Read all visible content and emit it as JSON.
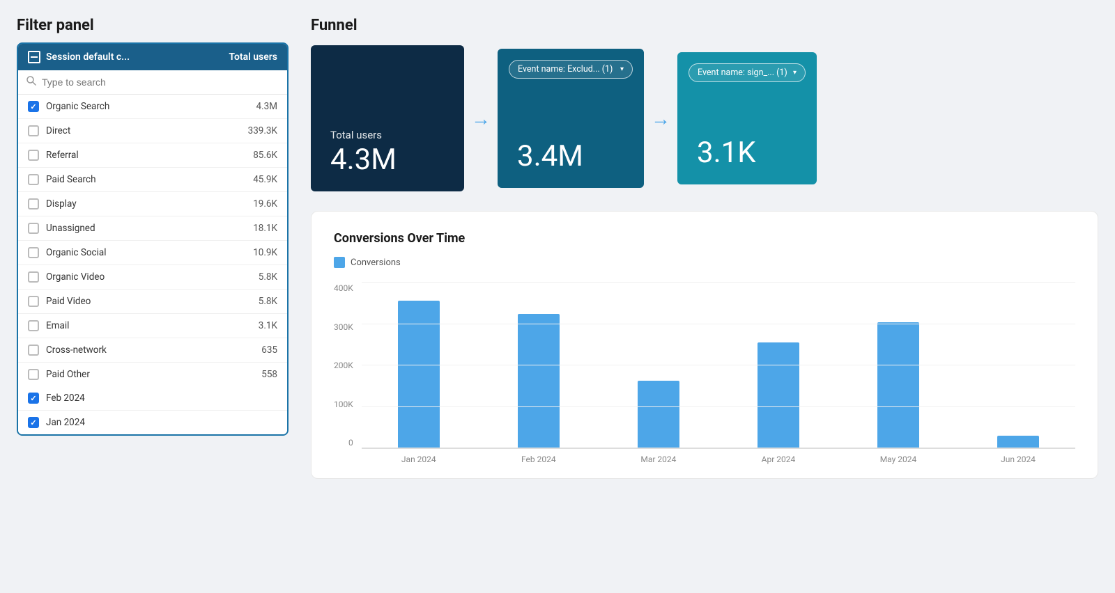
{
  "filterPanel": {
    "title": "Filter panel",
    "header": {
      "icon": "minus",
      "label": "Session default c...",
      "value": "Total users"
    },
    "search": {
      "placeholder": "Type to search"
    },
    "items": [
      {
        "id": 1,
        "name": "Organic Search",
        "value": "4.3M",
        "checked": true
      },
      {
        "id": 2,
        "name": "Direct",
        "value": "339.3K",
        "checked": false
      },
      {
        "id": 3,
        "name": "Referral",
        "value": "85.6K",
        "checked": false
      },
      {
        "id": 4,
        "name": "Paid Search",
        "value": "45.9K",
        "checked": false
      },
      {
        "id": 5,
        "name": "Display",
        "value": "19.6K",
        "checked": false
      },
      {
        "id": 6,
        "name": "Unassigned",
        "value": "18.1K",
        "checked": false
      },
      {
        "id": 7,
        "name": "Organic Social",
        "value": "10.9K",
        "checked": false
      },
      {
        "id": 8,
        "name": "Organic Video",
        "value": "5.8K",
        "checked": false
      },
      {
        "id": 9,
        "name": "Paid Video",
        "value": "5.8K",
        "checked": false
      },
      {
        "id": 10,
        "name": "Email",
        "value": "3.1K",
        "checked": false
      },
      {
        "id": 11,
        "name": "Cross-network",
        "value": "635",
        "checked": false
      },
      {
        "id": 12,
        "name": "Paid Other",
        "value": "558",
        "checked": false
      }
    ],
    "dateItems": [
      {
        "id": 13,
        "name": "Feb 2024",
        "value": "",
        "checked": true
      },
      {
        "id": 14,
        "name": "Jan 2024",
        "value": "",
        "checked": true
      }
    ]
  },
  "funnel": {
    "title": "Funnel",
    "cards": [
      {
        "id": 1,
        "label": "Total users",
        "value": "4.3M",
        "hasBadge": false
      },
      {
        "id": 2,
        "label": "",
        "value": "3.4M",
        "hasBadge": true,
        "badge": "Event name: Exclud... (1)"
      },
      {
        "id": 3,
        "label": "",
        "value": "3.1K",
        "hasBadge": true,
        "badge": "Event name: sign_... (1)"
      }
    ],
    "arrow": "→"
  },
  "conversionsChart": {
    "title": "Conversions Over Time",
    "legend": {
      "label": "Conversions",
      "color": "#4da6e8"
    },
    "yLabels": [
      "400K",
      "300K",
      "200K",
      "100K",
      "0"
    ],
    "bars": [
      {
        "month": "Jan 2024",
        "value": 355000,
        "heightPct": 88
      },
      {
        "month": "Feb 2024",
        "value": 320000,
        "heightPct": 80
      },
      {
        "month": "Mar 2024",
        "value": 160000,
        "heightPct": 40
      },
      {
        "month": "Apr 2024",
        "value": 255000,
        "heightPct": 63
      },
      {
        "month": "May 2024",
        "value": 300000,
        "heightPct": 75
      },
      {
        "month": "Jun 2024",
        "value": 28000,
        "heightPct": 7
      }
    ]
  }
}
